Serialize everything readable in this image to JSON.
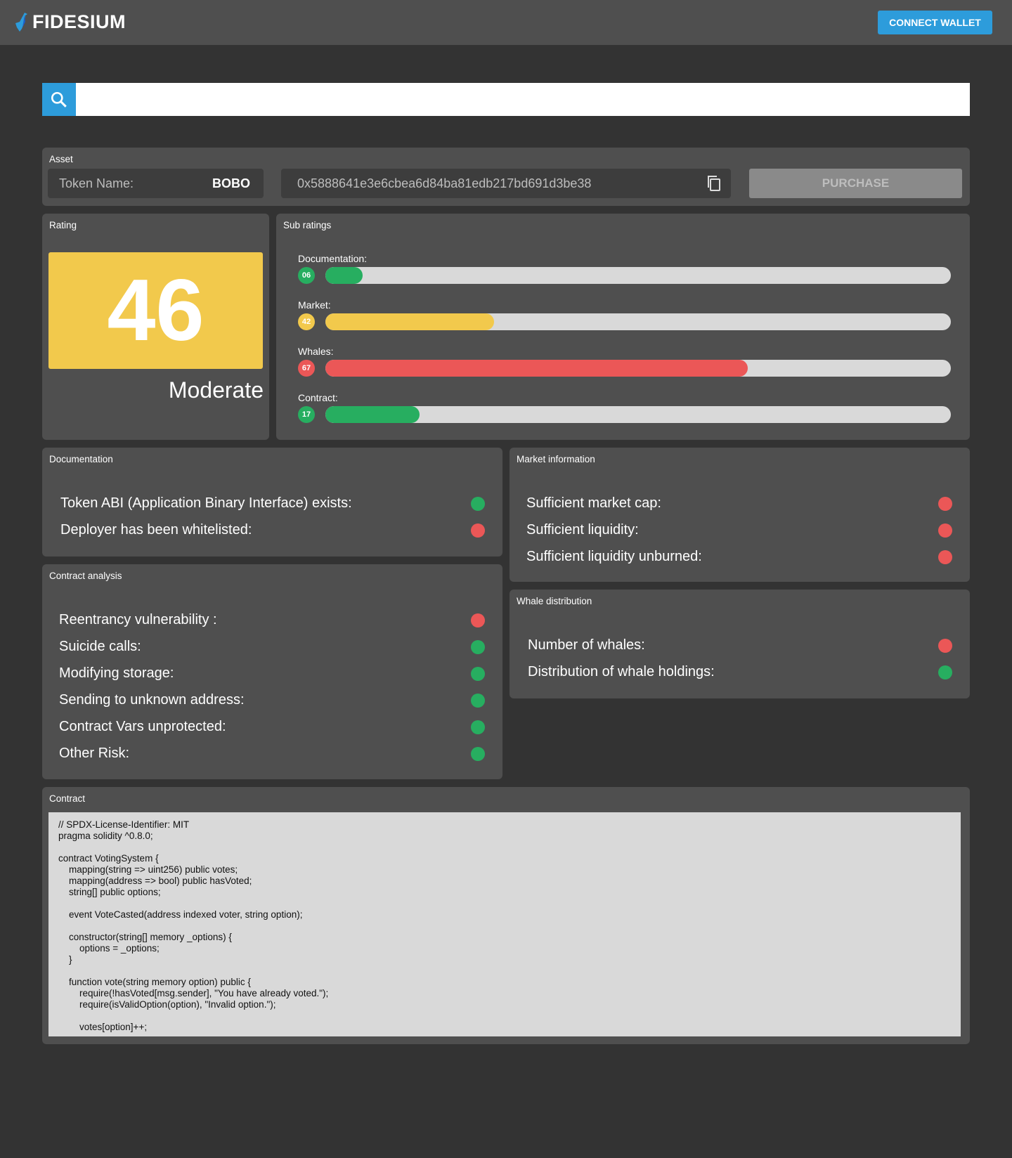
{
  "header": {
    "brand": "FIDESIUM",
    "connect_label": "CONNECT WALLET"
  },
  "search": {
    "value": "",
    "placeholder": ""
  },
  "asset": {
    "title": "Asset",
    "token_label": "Token Name:",
    "token_value": "BOBO",
    "address": "0x5888641e3e6cbea6d84ba81edb217bd691d3be38",
    "purchase_label": "PURCHASE"
  },
  "rating": {
    "title": "Rating",
    "score": "46",
    "verdict": "Moderate",
    "color": "#f2c94c"
  },
  "sub_ratings": {
    "title": "Sub ratings",
    "items": [
      {
        "label": "Documentation:",
        "value": "06",
        "fill_percent": 6,
        "color": "#27ae60"
      },
      {
        "label": "Market:",
        "value": "42",
        "fill_percent": 27,
        "color": "#f2c94c"
      },
      {
        "label": "Whales:",
        "value": "67",
        "fill_percent": 67.5,
        "color": "#eb5757"
      },
      {
        "label": "Contract:",
        "value": "17",
        "fill_percent": 15,
        "color": "#27ae60"
      }
    ]
  },
  "documentation": {
    "title": "Documentation",
    "items": [
      {
        "label": "Token ABI (Application Binary Interface) exists:",
        "status": "green"
      },
      {
        "label": "Deployer has been whitelisted:",
        "status": "red"
      }
    ]
  },
  "market": {
    "title": "Market information",
    "items": [
      {
        "label": "Sufficient market cap:",
        "status": "red"
      },
      {
        "label": "Sufficient liquidity:",
        "status": "red"
      },
      {
        "label": "Sufficient liquidity unburned:",
        "status": "red"
      }
    ]
  },
  "contract_analysis": {
    "title": "Contract analysis",
    "items": [
      {
        "label": "Reentrancy vulnerability :",
        "status": "red"
      },
      {
        "label": "Suicide calls:",
        "status": "green"
      },
      {
        "label": "Modifying storage:",
        "status": "green"
      },
      {
        "label": "Sending to unknown address:",
        "status": "green"
      },
      {
        "label": "Contract Vars unprotected:",
        "status": "green"
      },
      {
        "label": "Other Risk:",
        "status": "green"
      }
    ]
  },
  "whales": {
    "title": "Whale distribution",
    "items": [
      {
        "label": "Number of whales:",
        "status": "red"
      },
      {
        "label": "Distribution of whale holdings:",
        "status": "green"
      }
    ]
  },
  "contract": {
    "title": "Contract",
    "code": "// SPDX-License-Identifier: MIT\npragma solidity ^0.8.0;\n\ncontract VotingSystem {\n    mapping(string => uint256) public votes;\n    mapping(address => bool) public hasVoted;\n    string[] public options;\n\n    event VoteCasted(address indexed voter, string option);\n\n    constructor(string[] memory _options) {\n        options = _options;\n    }\n\n    function vote(string memory option) public {\n        require(!hasVoted[msg.sender], \"You have already voted.\");\n        require(isValidOption(option), \"Invalid option.\");\n\n        votes[option]++;"
  },
  "colors": {
    "green": "#27ae60",
    "red": "#eb5757",
    "accent": "#2d9cdb"
  }
}
